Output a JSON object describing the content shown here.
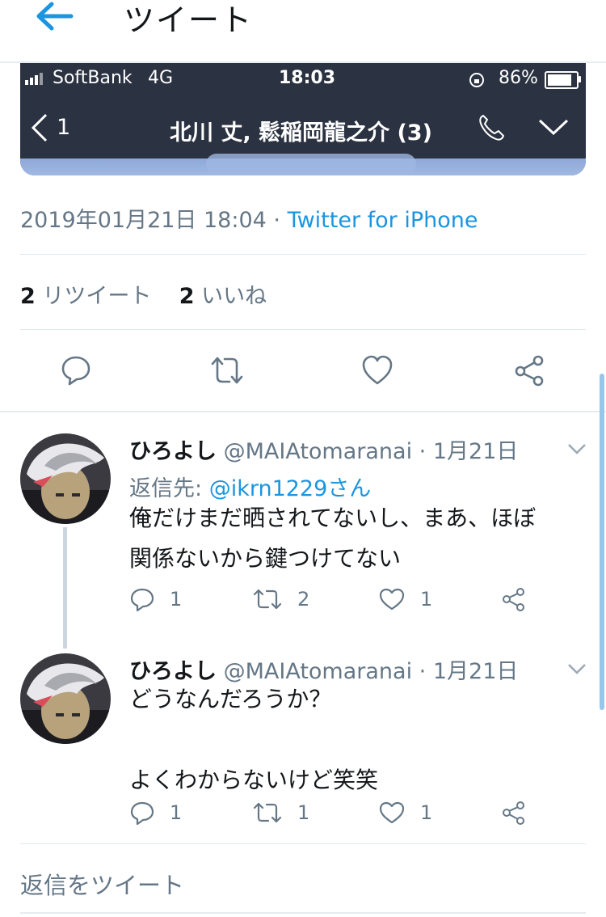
{
  "header": {
    "title": "ツイート"
  },
  "embedded_screenshot": {
    "carrier": "SoftBank",
    "network": "4G",
    "time": "18:03",
    "battery_percent": "86%",
    "battery_level": 0.86,
    "back_count": "1",
    "chat_title": "北川 丈, 鬆稲岡龍之介 (3)"
  },
  "tweet_meta": {
    "timestamp": "2019年01月21日 18:04",
    "separator": " · ",
    "source": "Twitter for iPhone"
  },
  "stats": {
    "retweets_count": "2",
    "retweets_label": "リツイート",
    "likes_count": "2",
    "likes_label": "いいね"
  },
  "main_actions": [
    "reply-icon",
    "retweet-icon",
    "like-icon",
    "share-icon"
  ],
  "replies": [
    {
      "name": "ひろよし",
      "handle": "@MAIAtomaranai",
      "date": "1月21日",
      "reply_to_label": "返信先: ",
      "reply_to_mention": "@ikrn1229さん",
      "text": "俺だけまだ晒されてないし、まあ、ほぼ\n関係ないから鍵つけてない",
      "reply_count": "1",
      "retweet_count": "2",
      "like_count": "1"
    },
    {
      "name": "ひろよし",
      "handle": "@MAIAtomaranai",
      "date": "1月21日",
      "text": "どうなんだろうか？\n\nよくわからないけど笑笑",
      "reply_count": "1",
      "retweet_count": "1",
      "like_count": "1"
    }
  ],
  "compose": {
    "placeholder": "返信をツイート"
  },
  "colors": {
    "accent": "#1b95e0",
    "muted": "#657786",
    "embed_bg": "#2b3241"
  }
}
